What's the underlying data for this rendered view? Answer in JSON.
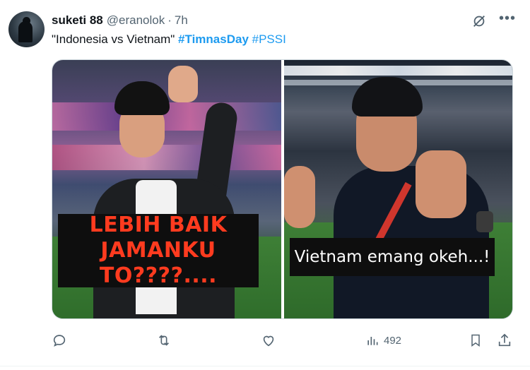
{
  "author": {
    "display_name": "suketi 88",
    "handle": "@eranolok",
    "separator": "·",
    "time": "7h"
  },
  "tweet": {
    "quote_text": "\"Indonesia vs Vietnam\"",
    "hashtag_1": "#TimnasDay",
    "hashtag_2": "#PSSI"
  },
  "media": {
    "left_caption_line1": "LEBIH BAIK JAMANKU",
    "left_caption_line2": "TO????....",
    "right_caption": "Vietnam emang okeh...!"
  },
  "actions": {
    "views": "492"
  },
  "colors": {
    "accent": "#1d9bf0",
    "muted": "#536471",
    "caption_red": "#ff3b1f"
  },
  "icons": [
    "grok-icon",
    "more-icon",
    "reply-icon",
    "retweet-icon",
    "like-icon",
    "views-icon",
    "bookmark-icon",
    "share-icon"
  ]
}
